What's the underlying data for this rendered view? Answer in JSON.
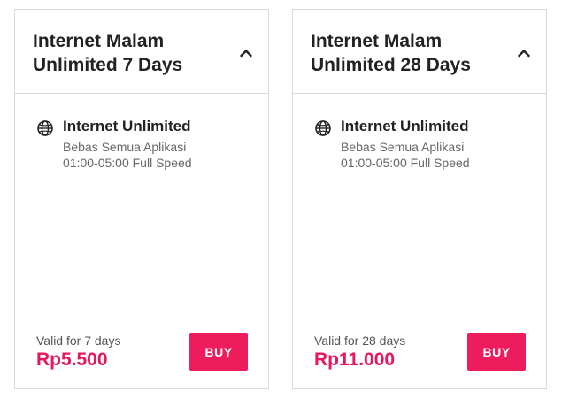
{
  "packages": [
    {
      "title": "Internet Malam Unlimited 7 Days",
      "feature_title": "Internet Unlimited",
      "feature_desc_line1": "Bebas Semua Aplikasi",
      "feature_desc_line2": "01:00-05:00 Full Speed",
      "validity": "Valid for 7 days",
      "price": "Rp5.500",
      "buy_label": "BUY"
    },
    {
      "title": "Internet Malam Unlimited 28 Days",
      "feature_title": "Internet Unlimited",
      "feature_desc_line1": "Bebas Semua Aplikasi",
      "feature_desc_line2": "01:00-05:00 Full Speed",
      "validity": "Valid for 28 days",
      "price": "Rp11.000",
      "buy_label": "BUY"
    }
  ],
  "icons": {
    "toggle": "chevron-up-icon",
    "feature": "globe-icon"
  },
  "colors": {
    "accent": "#ed1c5d",
    "price": "#e8175d",
    "border": "#d9d9d9",
    "title": "#222222"
  }
}
